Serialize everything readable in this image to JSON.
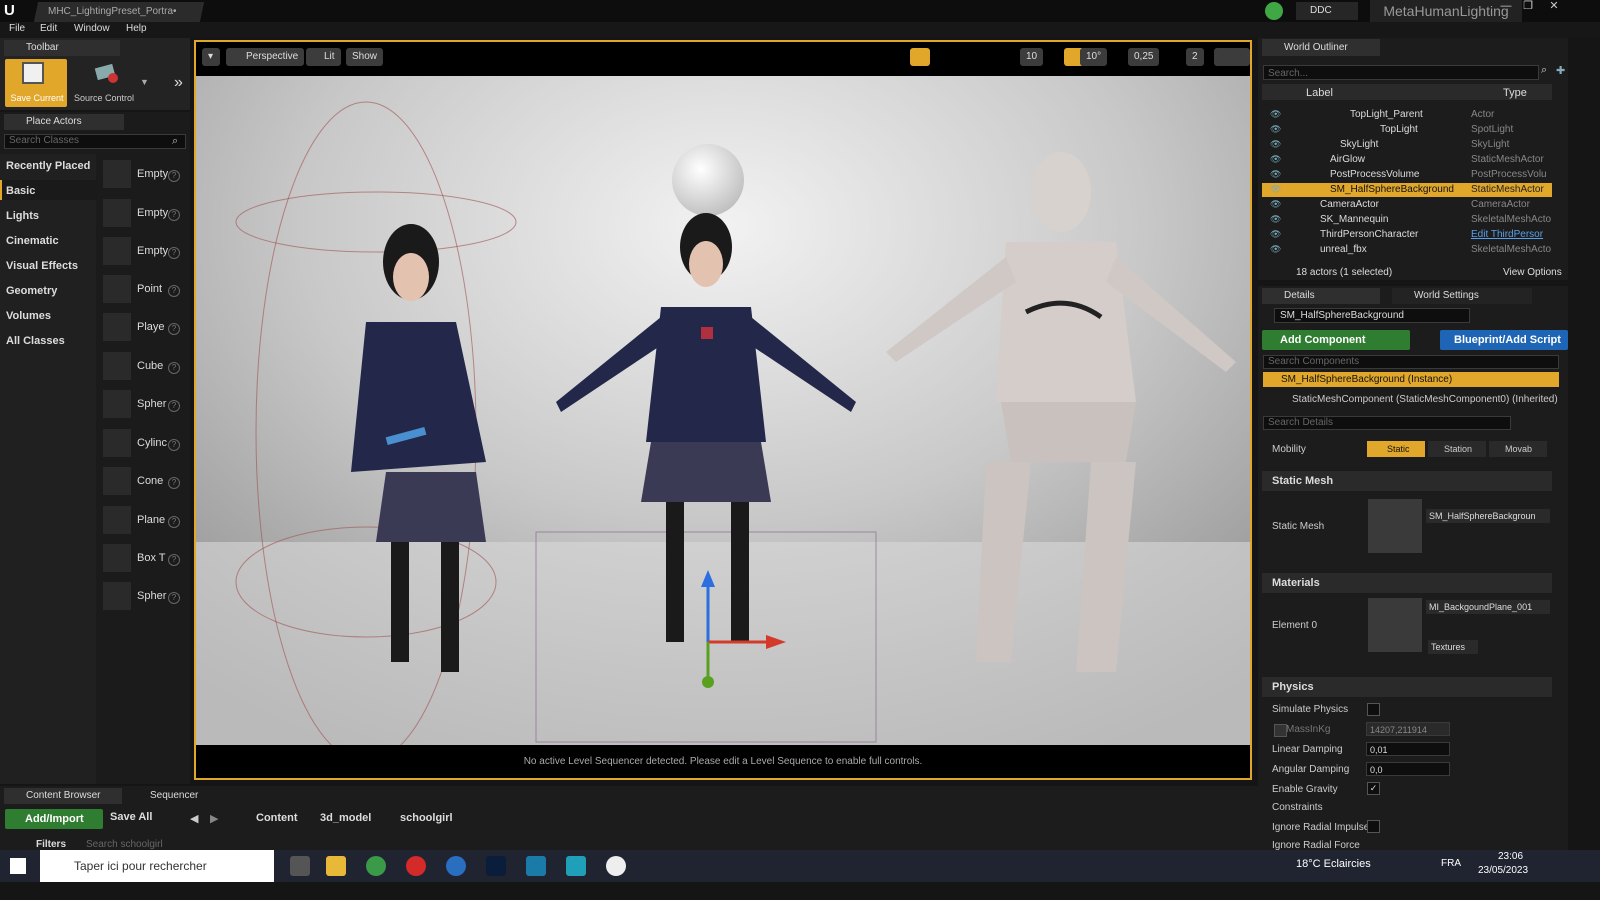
{
  "titlebar": {
    "project_tab": "MHC_LightingPreset_Portra•",
    "ddc": "DDC",
    "app_name": "MetaHumanLighting",
    "window_buttons": [
      "—",
      "❐",
      "✕"
    ]
  },
  "menu": [
    "File",
    "Edit",
    "Window",
    "Help"
  ],
  "toolbar": {
    "tab_label": "Toolbar",
    "save_current": "Save Current",
    "source_control": "Source Control"
  },
  "place_actors": {
    "tab_label": "Place Actors",
    "search_placeholder": "Search Classes",
    "categories": [
      "Recently Placed",
      "Basic",
      "Lights",
      "Cinematic",
      "Visual Effects",
      "Geometry",
      "Volumes",
      "All Classes"
    ],
    "active_category": "Basic",
    "items": [
      "Empty",
      "Empty",
      "Empty",
      "Point",
      "Playe",
      "Cube",
      "Spher",
      "Cylinc",
      "Cone",
      "Plane",
      "Box T",
      "Spher"
    ]
  },
  "viewport": {
    "dropdown_label": "▾",
    "perspective": "Perspective",
    "lit": "Lit",
    "show": "Show",
    "grid_snap": "10",
    "rot_snap": "10°",
    "scale_snap": "0,25",
    "cam_speed": "2",
    "message": "No active Level Sequencer detected. Please edit a Level Sequence to enable full controls."
  },
  "outliner": {
    "tab_label": "World Outliner",
    "search_placeholder": "Search...",
    "col_label": "Label",
    "col_type": "Type",
    "rows": [
      {
        "label": "TopLight_Parent",
        "type": "Actor"
      },
      {
        "label": "TopLight",
        "type": "SpotLight"
      },
      {
        "label": "SkyLight",
        "type": "SkyLight"
      },
      {
        "label": "AirGlow",
        "type": "StaticMeshActor"
      },
      {
        "label": "PostProcessVolume",
        "type": "PostProcessVolu"
      },
      {
        "label": "SM_HalfSphereBackground",
        "type": "StaticMeshActor"
      },
      {
        "label": "CameraActor",
        "type": "CameraActor"
      },
      {
        "label": "SK_Mannequin",
        "type": "SkeletalMeshActo"
      },
      {
        "label": "ThirdPersonCharacter",
        "type": "Edit ThirdPersor"
      },
      {
        "label": "unreal_fbx",
        "type": "SkeletalMeshActo"
      }
    ],
    "status": "18 actors (1 selected)",
    "view_options": "View Options"
  },
  "details": {
    "tab_details": "Details",
    "tab_world_settings": "World Settings",
    "object_name": "SM_HalfSphereBackground",
    "add_component": "Add Component",
    "blueprint": "Blueprint/Add Script",
    "search_components": "Search Components",
    "instance_row": "SM_HalfSphereBackground (Instance)",
    "component_row": "StaticMeshComponent (StaticMeshComponent0) (Inherited)",
    "search_details": "Search Details",
    "mobility_label": "Mobility",
    "mobility_options": [
      "Static",
      "Station",
      "Movab"
    ],
    "static_mesh_section": "Static Mesh",
    "static_mesh_label": "Static Mesh",
    "static_mesh_value": "SM_HalfSphereBackgroun",
    "materials_section": "Materials",
    "element0_label": "Element 0",
    "element0_value": "MI_BackgoundPlane_001",
    "textures_btn": "Textures",
    "physics_section": "Physics",
    "simulate_physics": "Simulate Physics",
    "mass_label": "MassInKg",
    "mass_value": "14207,211914",
    "linear_damping_label": "Linear Damping",
    "linear_damping_value": "0,01",
    "angular_damping_label": "Angular Damping",
    "angular_damping_value": "0,0",
    "enable_gravity": "Enable Gravity",
    "constraints": "Constraints",
    "ignore_radial_impulse": "Ignore Radial Impulse",
    "ignore_radial_force": "Ignore Radial Force"
  },
  "content_browser": {
    "tab_label": "Content Browser",
    "sequencer_tab": "Sequencer",
    "add_import": "Add/Import",
    "save_all": "Save All",
    "path": [
      "Content",
      "3d_model",
      "schoolgirl"
    ],
    "filters": "Filters",
    "search_placeholder": "Search schoolgirl"
  },
  "taskbar": {
    "search_placeholder": "Taper ici pour rechercher",
    "weather": "18°C Eclaircies",
    "lang": "FRA",
    "time": "23:06",
    "date": "23/05/2023"
  },
  "colors": {
    "accent": "#e1a72b",
    "add_green": "#2f7d30",
    "blueprint_blue": "#1e66b5",
    "selected_row": "#e1a72b"
  }
}
